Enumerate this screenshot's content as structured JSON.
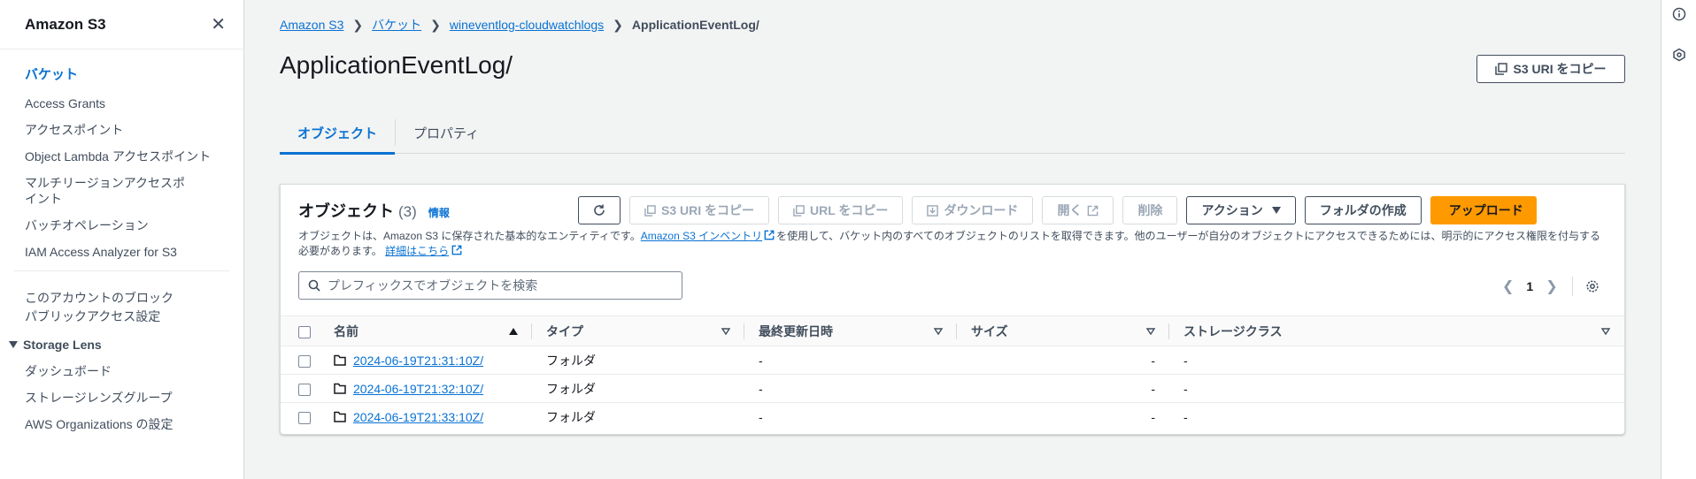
{
  "sidebar": {
    "title": "Amazon S3",
    "items": [
      {
        "label": "バケット",
        "active": true
      },
      {
        "label": "Access Grants"
      },
      {
        "label": "アクセスポイント"
      },
      {
        "label": "Object Lambda アクセスポイント"
      },
      {
        "label": "マルチリージョンアクセスポイント"
      },
      {
        "label": "バッチオペレーション"
      },
      {
        "label": "IAM Access Analyzer for S3"
      }
    ],
    "block_public_access": "このアカウントのブロックパブリックアクセス設定",
    "storage_lens": {
      "label": "Storage Lens",
      "items": [
        {
          "label": "ダッシュボード"
        },
        {
          "label": "ストレージレンズグループ"
        },
        {
          "label": "AWS Organizations の設定"
        }
      ]
    }
  },
  "breadcrumb": {
    "items": [
      "Amazon S3",
      "バケット",
      "wineventlog-cloudwatchlogs"
    ],
    "current": "ApplicationEventLog/"
  },
  "page": {
    "title": "ApplicationEventLog/",
    "copy_uri_label": "S3 URI をコピー"
  },
  "tabs": [
    {
      "label": "オブジェクト",
      "active": true
    },
    {
      "label": "プロパティ"
    }
  ],
  "objects_panel": {
    "title": "オブジェクト",
    "count": "(3)",
    "info": "情報",
    "desc_part1": "オブジェクトは、Amazon S3 に保存された基本的なエンティティです。",
    "desc_link1": "Amazon S3 インベントリ",
    "desc_part2": "を使用して、バケット内のすべてのオブジェクトのリストを取得できます。他のユーザーが自分のオブジェクトにアクセスできるためには、明示的にアクセス権限を付与する必要があります。",
    "desc_link2": "詳細はこちら",
    "toolbar": {
      "copy_s3_uri": "S3 URI をコピー",
      "copy_url": "URL をコピー",
      "download": "ダウンロード",
      "open": "開く",
      "delete": "削除",
      "actions": "アクション",
      "create_folder": "フォルダの作成",
      "upload": "アップロード"
    },
    "search_placeholder": "プレフィックスでオブジェクトを検索",
    "page_number": "1",
    "columns": {
      "name": "名前",
      "type": "タイプ",
      "last_modified": "最終更新日時",
      "size": "サイズ",
      "storage_class": "ストレージクラス"
    },
    "rows": [
      {
        "name": "2024-06-19T21:31:10Z/",
        "type": "フォルダ",
        "last_modified": "-",
        "size": "-",
        "storage_class": "-"
      },
      {
        "name": "2024-06-19T21:32:10Z/",
        "type": "フォルダ",
        "last_modified": "-",
        "size": "-",
        "storage_class": "-"
      },
      {
        "name": "2024-06-19T21:33:10Z/",
        "type": "フォルダ",
        "last_modified": "-",
        "size": "-",
        "storage_class": "-"
      }
    ]
  },
  "colors": {
    "link": "#0972d3",
    "primary": "#ff9900",
    "text": "#16191f",
    "muted": "#414d5c"
  }
}
